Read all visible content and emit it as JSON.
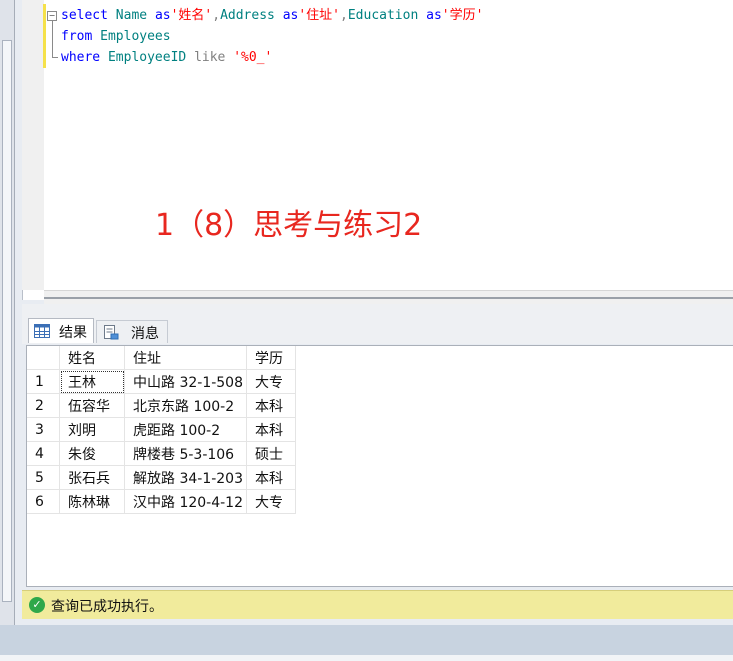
{
  "editor": {
    "lines": [
      [
        {
          "t": "select ",
          "c": "kw"
        },
        {
          "t": "Name ",
          "c": "id"
        },
        {
          "t": "as",
          "c": "kw"
        },
        {
          "t": "'姓名'",
          "c": "str"
        },
        {
          "t": ",",
          "c": "gr"
        },
        {
          "t": "Address ",
          "c": "id"
        },
        {
          "t": "as",
          "c": "kw"
        },
        {
          "t": "'住址'",
          "c": "str"
        },
        {
          "t": ",",
          "c": "gr"
        },
        {
          "t": "Education ",
          "c": "id"
        },
        {
          "t": "as",
          "c": "kw"
        },
        {
          "t": "'学历'",
          "c": "str"
        }
      ],
      [
        {
          "t": "from ",
          "c": "kw"
        },
        {
          "t": "Employees",
          "c": "id"
        }
      ],
      [
        {
          "t": "where ",
          "c": "kw"
        },
        {
          "t": "EmployeeID ",
          "c": "id"
        },
        {
          "t": "like ",
          "c": "gr"
        },
        {
          "t": "'%0_'",
          "c": "str"
        }
      ]
    ],
    "overlay_text": "1（8）思考与练习2"
  },
  "tabs": {
    "results_label": "结果",
    "messages_label": "消息"
  },
  "grid": {
    "columns": [
      "姓名",
      "住址",
      "学历"
    ],
    "rows": [
      {
        "num": "1",
        "cells": [
          "王林",
          "中山路 32-1-508",
          "大专"
        ]
      },
      {
        "num": "2",
        "cells": [
          "伍容华",
          "北京东路 100-2",
          "本科"
        ]
      },
      {
        "num": "3",
        "cells": [
          "刘明",
          "虎距路 100-2",
          "本科"
        ]
      },
      {
        "num": "4",
        "cells": [
          "朱俊",
          "牌楼巷 5-3-106",
          "硕士"
        ]
      },
      {
        "num": "5",
        "cells": [
          "张石兵",
          "解放路 34-1-203",
          "本科"
        ]
      },
      {
        "num": "6",
        "cells": [
          "陈林琳",
          "汉中路 120-4-12",
          "大专"
        ]
      }
    ]
  },
  "status": {
    "text": "查询已成功执行。",
    "icon": "success-check-icon",
    "color": "#2fa84a"
  }
}
